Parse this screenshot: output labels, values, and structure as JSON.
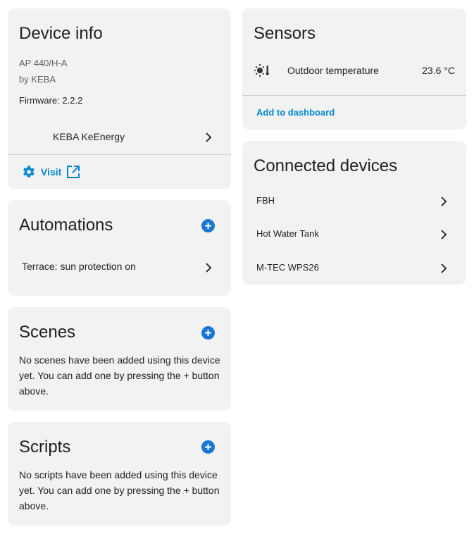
{
  "device_info": {
    "title": "Device info",
    "model": "AP 440/H-A",
    "manufacturer": "by KEBA",
    "firmware": "Firmware: 2.2.2",
    "integration": "KEBA KeEnergy",
    "visit_label": "Visit"
  },
  "automations": {
    "title": "Automations",
    "items": [
      {
        "label": "Terrace: sun protection on"
      }
    ]
  },
  "scenes": {
    "title": "Scenes",
    "empty_text": "No scenes have been added using this device yet. You can add one by pressing the + button above."
  },
  "scripts": {
    "title": "Scripts",
    "empty_text": "No scripts have been added using this device yet. You can add one by pressing the + button above."
  },
  "sensors": {
    "title": "Sensors",
    "items": [
      {
        "icon": "sun-thermometer-icon",
        "label": "Outdoor temperature",
        "value": "23.6 °C"
      }
    ],
    "add_label": "Add to dashboard"
  },
  "connected_devices": {
    "title": "Connected devices",
    "items": [
      {
        "label": "FBH"
      },
      {
        "label": "Hot Water Tank"
      },
      {
        "label": "M-TEC WPS26"
      }
    ]
  },
  "colors": {
    "accent": "#1976d2",
    "link": "#0288d1",
    "card_bg": "#f2f2f2"
  }
}
